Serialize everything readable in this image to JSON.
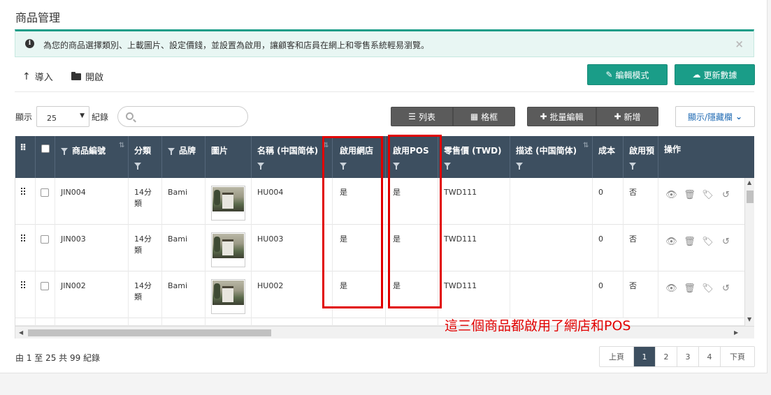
{
  "page": {
    "title": "商品管理"
  },
  "alert": {
    "text": "為您的商品選擇類別、上載圖片、設定價錢，並設置為啟用，讓顧客和店員在網上和零售系統輕易瀏覽。",
    "close": "×"
  },
  "toolbar": {
    "import_label": "導入",
    "open_label": "開啟",
    "edit_mode_label": "編輯模式",
    "update_data_label": "更新數據"
  },
  "controls": {
    "show_label": "顯示",
    "page_size": "25",
    "records_label": "紀錄",
    "search_placeholder": "",
    "list_label": "列表",
    "grid_label": "格框",
    "batch_edit_label": "批量編輯",
    "add_label": "新增",
    "show_hide_label": "顯示/隱藏欄"
  },
  "table": {
    "headers": {
      "code": "商品編號",
      "category": "分類",
      "brand": "品牌",
      "image": "圖片",
      "name": "名稱 (中国简体)",
      "online": "啟用網店",
      "pos": "啟用POS",
      "price": "零售價 (TWD)",
      "desc": "描述 (中国简体)",
      "cost": "成本",
      "enabled": "啟用預",
      "actions": "操作"
    },
    "rows": [
      {
        "code": "JIN004",
        "category": "14分類",
        "brand": "Bami",
        "name": "HU004",
        "online": "是",
        "pos": "是",
        "price": "TWD111",
        "desc": "",
        "cost": "0",
        "enabled": "否"
      },
      {
        "code": "JIN003",
        "category": "14分類",
        "brand": "Bami",
        "name": "HU003",
        "online": "是",
        "pos": "是",
        "price": "TWD111",
        "desc": "",
        "cost": "0",
        "enabled": "否"
      },
      {
        "code": "JIN002",
        "category": "14分類",
        "brand": "Bami",
        "name": "HU002",
        "online": "是",
        "pos": "是",
        "price": "TWD111",
        "desc": "",
        "cost": "0",
        "enabled": "否"
      }
    ]
  },
  "annotation": {
    "text": "這三個商品都啟用了網店和POS",
    "color": "#e10000"
  },
  "footer": {
    "info": "由 1 至 25 共 99 紀錄"
  },
  "pagination": {
    "prev": "上頁",
    "pages": [
      "1",
      "2",
      "3",
      "4"
    ],
    "current": "1",
    "next": "下頁"
  },
  "colors": {
    "accent": "#1a9d88",
    "header": "#3d4f60",
    "link": "#1f6ab3"
  }
}
